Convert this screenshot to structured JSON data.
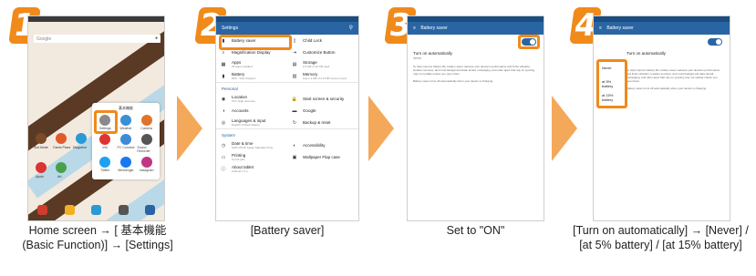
{
  "steps": [
    {
      "number": "1",
      "caption": "Home screen → [ 基本機能 (Basic Function)] → [Settings]"
    },
    {
      "number": "2",
      "caption": "[Battery saver]"
    },
    {
      "number": "3",
      "caption": "Set to \"ON\""
    },
    {
      "number": "4",
      "caption": "[Turn on automatically] → [Never] / [at 5% battery] / [at 15% battery]"
    }
  ],
  "home": {
    "search_label": "Google",
    "folder_title": "基本機能",
    "folder_apps": [
      {
        "label": "Settings",
        "color": "#8a8a8a"
      },
      {
        "label": "Weather",
        "color": "#3a8fd6"
      },
      {
        "label": "Camera",
        "color": "#e0742a"
      },
      {
        "label": "Info",
        "color": "#d33"
      },
      {
        "label": "PC Connect",
        "color": "#3d8ad6"
      },
      {
        "label": "Sound Recorder",
        "color": "#555"
      },
      {
        "label": "Twitter",
        "color": "#1da1f2"
      },
      {
        "label": "Messenger",
        "color": "#1877f2"
      },
      {
        "label": "Instagram",
        "color": "#c13584"
      }
    ],
    "home_icons": [
      {
        "label": "Slot Mode",
        "color": "#7a4a2a"
      },
      {
        "label": "Game Plaza",
        "color": "#e05a2a"
      },
      {
        "label": "Magazine",
        "color": "#2a9ad6"
      },
      {
        "label": "Ayoto",
        "color": "#d33"
      },
      {
        "label": "Art",
        "color": "#4aa04a"
      }
    ],
    "dock_colors": [
      "#d23c2c",
      "#f0b020",
      "#2a9ad6",
      "#555555",
      "#2a65a3"
    ]
  },
  "settings": {
    "title": "Settings",
    "search_icon": "⚲",
    "rows_top": [
      [
        {
          "icon": "▮",
          "label": "Battery saver",
          "sub": ""
        },
        {
          "icon": "▯",
          "label": "Child Lock",
          "sub": ""
        }
      ],
      [
        {
          "icon": "⌕",
          "label": "Magnification Display",
          "sub": ""
        },
        {
          "icon": "⇥",
          "label": "Customize Button",
          "sub": ""
        }
      ],
      [
        {
          "icon": "▦",
          "label": "Apps",
          "sub": "25 apps installed"
        },
        {
          "icon": "▤",
          "label": "Storage",
          "sub": "2.6 GB of 16 GB used"
        }
      ],
      [
        {
          "icon": "▮",
          "label": "Battery",
          "sub": "99% - fully charged"
        },
        {
          "icon": "▥",
          "label": "Memory",
          "sub": "Avg 1.1 GB of 2.0 GB memory used"
        }
      ]
    ],
    "personal_label": "Personal",
    "rows_personal": [
      [
        {
          "icon": "◉",
          "label": "Location",
          "sub": "ON / High accuracy"
        },
        {
          "icon": "🔒",
          "label": "Start screen & security",
          "sub": ""
        }
      ],
      [
        {
          "icon": "◑",
          "label": "Accounts",
          "sub": ""
        },
        {
          "icon": "▬",
          "label": "Google",
          "sub": ""
        }
      ],
      [
        {
          "icon": "◎",
          "label": "Languages & input",
          "sub": "English (United States)"
        },
        {
          "icon": "↻",
          "label": "Backup & reset",
          "sub": ""
        }
      ]
    ],
    "system_label": "System",
    "rows_system": [
      [
        {
          "icon": "◷",
          "label": "Date & time",
          "sub": "GMT+09:00 Japan Standard Time"
        },
        {
          "icon": "◐",
          "label": "Accessibility",
          "sub": ""
        }
      ],
      [
        {
          "icon": "▭",
          "label": "Printing",
          "sub": "0 print jobs"
        },
        {
          "icon": "▣",
          "label": "Wallpaper Flap case",
          "sub": ""
        }
      ],
      [
        {
          "icon": "ⓘ",
          "label": "About tablet",
          "sub": "Android 7.1.1"
        },
        {
          "icon": "",
          "label": "",
          "sub": ""
        }
      ]
    ]
  },
  "battery_saver": {
    "title": "Battery saver",
    "menu_icon": "≡",
    "setting_label": "Turn on automatically",
    "setting_value": "Never",
    "description": "To help improve battery life, battery saver reduces your device's performance and limits vibration, location services, and most background data. Email, messaging, and other apps that rely on syncing may not update unless you open them.",
    "description2": "Battery saver turns off automatically when your device is charging.",
    "toggle_state": "ON"
  },
  "auto_popup": {
    "options": [
      "Never",
      "at 5% battery",
      "at 15% battery"
    ]
  },
  "colors": {
    "accent_orange": "#f08a1a",
    "app_blue": "#2a65a3",
    "arrow_orange": "#f4a85a"
  }
}
